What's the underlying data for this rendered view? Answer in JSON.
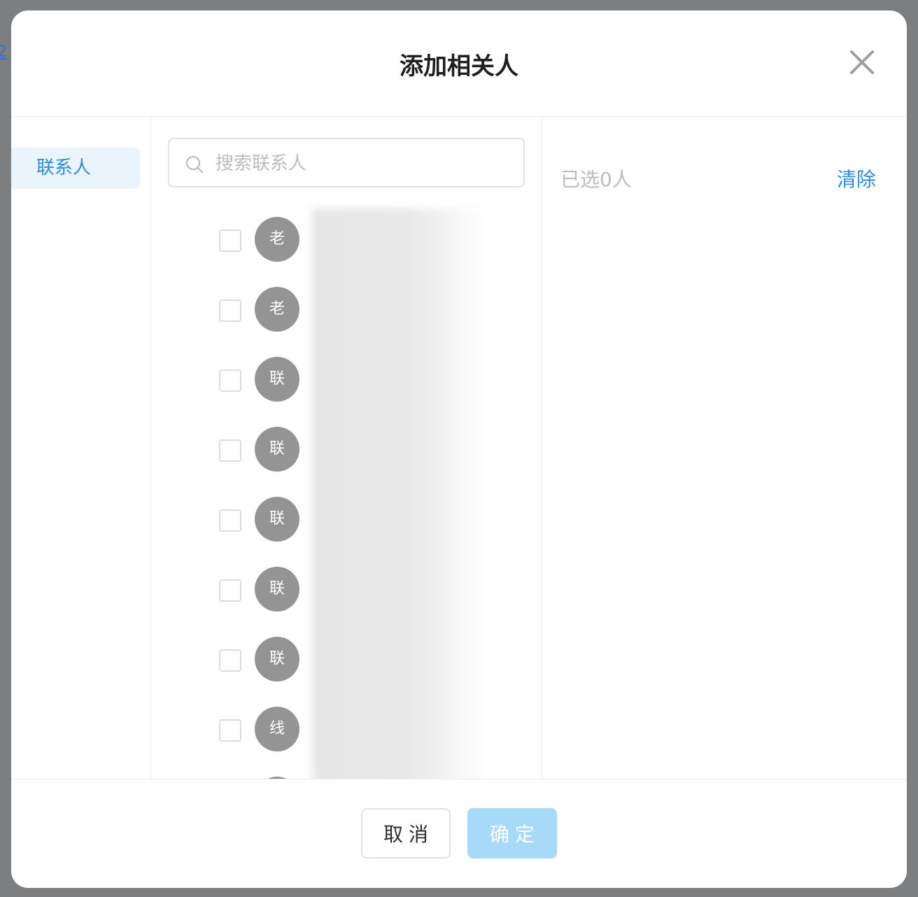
{
  "background": {
    "link_text": "2"
  },
  "dialog": {
    "title": "添加相关人",
    "close_icon": "close-icon"
  },
  "nav": {
    "items": [
      {
        "label": "联系人",
        "active": true
      }
    ]
  },
  "search": {
    "placeholder": "搜索联系人",
    "value": "",
    "icon": "search-icon"
  },
  "contacts": [
    {
      "initial": "老",
      "checked": false
    },
    {
      "initial": "老",
      "checked": false
    },
    {
      "initial": "联",
      "checked": false
    },
    {
      "initial": "联",
      "checked": false
    },
    {
      "initial": "联",
      "checked": false
    },
    {
      "initial": "联",
      "checked": false
    },
    {
      "initial": "联",
      "checked": false
    },
    {
      "initial": "线",
      "checked": false
    },
    {
      "initial": "",
      "checked": false
    }
  ],
  "selection": {
    "count_text": "已选0人",
    "clear_label": "清除"
  },
  "footer": {
    "cancel_label": "取消",
    "confirm_label": "确定"
  },
  "colors": {
    "accent": "#2f8ad8",
    "active_nav_bg": "#e9f4fd",
    "avatar_bg": "#949494",
    "confirm_disabled_bg": "#a6daf8",
    "overlay": "#7d7e80"
  }
}
